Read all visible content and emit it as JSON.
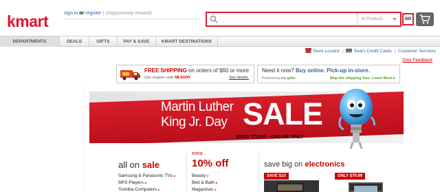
{
  "header": {
    "logo": "kmart",
    "signin": "sign in",
    "or": "or",
    "register": "register",
    "rewards": "| shopyourway rewards"
  },
  "search": {
    "placeholder": "",
    "category": "All Products",
    "go_label": "GO"
  },
  "nav": {
    "items": [
      {
        "label": "DEPARTMENTS"
      },
      {
        "label": "DEALS"
      },
      {
        "label": "GIFTS"
      },
      {
        "label": "PAY & SAVE"
      },
      {
        "label": "KMART DESTINATIONS"
      }
    ]
  },
  "utility": {
    "store_locator": "Store Locator",
    "credit_cards": "Sears Credit Cards",
    "customer_services": "Customer Services",
    "give_feedback": "Give Feedback"
  },
  "promo_shipping": {
    "title_bold": "FREE SHIPPING",
    "title_rest": "on orders of $60 or more",
    "coupon_prefix": "Use coupon code",
    "coupon_code": "MLKDAY",
    "details": "See details."
  },
  "promo_pickup": {
    "title_plain": "Need it now?",
    "title_bold": "Buy online. Pick-up in-store.",
    "powered_prefix": "Powered by",
    "powered_brand": "my gofer",
    "skip": "Skip the shipping fees. Learn More ▸"
  },
  "hero": {
    "line1": "Martin Luther",
    "line2": "King Jr. Day",
    "sale": "SALE",
    "ends": "ENDS TODAY - ONLINE ONLY"
  },
  "sections": {
    "all_on": "all on",
    "sale_word": "sale",
    "extra": "extra",
    "ten_off": "10% off",
    "save_big": "save big on",
    "electronics": "electronics"
  },
  "sale_list": [
    "Samsung & Panasonic TVs",
    "MP3 Players",
    "Toshiba Computers"
  ],
  "off_list": [
    "Beauty",
    "Bed & Bath",
    "Magazines"
  ],
  "deal_tags": [
    "SAVE $10",
    "ONLY $79.99"
  ],
  "colors": {
    "brand": "#e0142f",
    "accent": "#d6202d",
    "link": "#336699",
    "green": "#5c9a2d"
  }
}
